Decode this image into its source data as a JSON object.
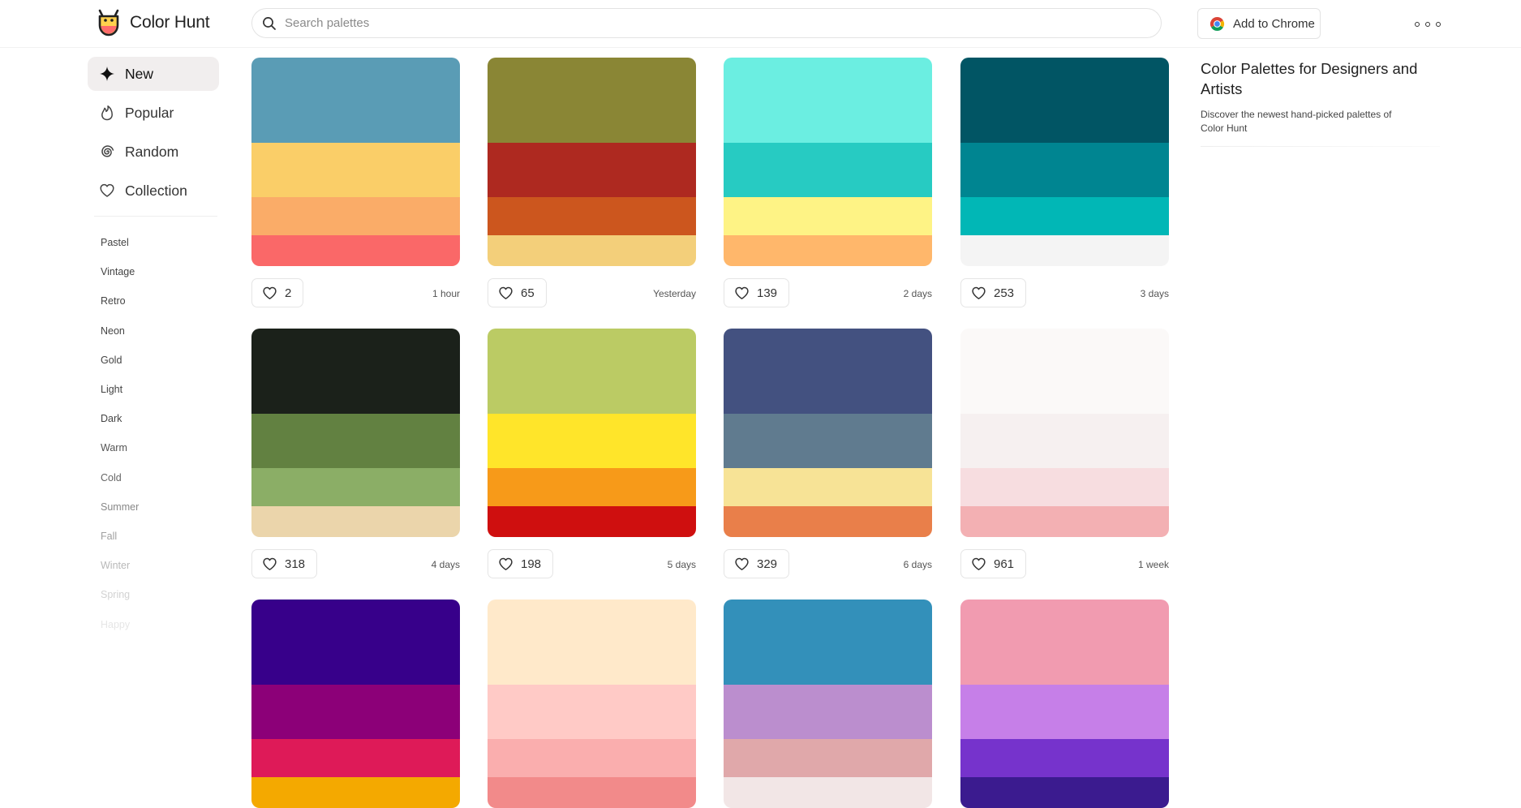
{
  "header": {
    "logo_text": "Color Hunt",
    "search_placeholder": "Search palettes",
    "chrome_label": "Add to Chrome"
  },
  "sidebar": {
    "nav": [
      {
        "label": "New",
        "icon": "sparkle-icon",
        "active": true
      },
      {
        "label": "Popular",
        "icon": "flame-icon",
        "active": false
      },
      {
        "label": "Random",
        "icon": "spiral-icon",
        "active": false
      },
      {
        "label": "Collection",
        "icon": "heart-icon",
        "active": false
      }
    ],
    "tags": [
      {
        "label": "Pastel",
        "color": "#444444"
      },
      {
        "label": "Vintage",
        "color": "#444444"
      },
      {
        "label": "Retro",
        "color": "#444444"
      },
      {
        "label": "Neon",
        "color": "#444444"
      },
      {
        "label": "Gold",
        "color": "#444444"
      },
      {
        "label": "Light",
        "color": "#444444"
      },
      {
        "label": "Dark",
        "color": "#444444"
      },
      {
        "label": "Warm",
        "color": "#555555"
      },
      {
        "label": "Cold",
        "color": "#666666"
      },
      {
        "label": "Summer",
        "color": "#888888"
      },
      {
        "label": "Fall",
        "color": "#a0a0a0"
      },
      {
        "label": "Winter",
        "color": "#b8b8b8"
      },
      {
        "label": "Spring",
        "color": "#d2d2d2"
      },
      {
        "label": "Happy",
        "color": "#e6e6e6"
      }
    ]
  },
  "palettes": [
    {
      "colors": [
        "#5A9CB5",
        "#FACE68",
        "#FAAC68",
        "#FA6868"
      ],
      "likes": "2",
      "time": "1 hour"
    },
    {
      "colors": [
        "#8A8635",
        "#AE2920",
        "#CC561E",
        "#F3CF7A"
      ],
      "likes": "65",
      "time": "Yesterday"
    },
    {
      "colors": [
        "#6BEEE1",
        "#27CBC2",
        "#FEF385",
        "#FFB76B"
      ],
      "likes": "139",
      "time": "2 days"
    },
    {
      "colors": [
        "#015564",
        "#008591",
        "#01B7B6",
        "#F4F4F4"
      ],
      "likes": "253",
      "time": "3 days"
    },
    {
      "colors": [
        "#1B211A",
        "#628141",
        "#8BAE66",
        "#EBD5AB"
      ],
      "likes": "318",
      "time": "4 days"
    },
    {
      "colors": [
        "#BBCB64",
        "#FFE52A",
        "#F79A19",
        "#CF0F0F"
      ],
      "likes": "198",
      "time": "5 days"
    },
    {
      "colors": [
        "#435180",
        "#607B8F",
        "#F7E396",
        "#E97F4A"
      ],
      "likes": "329",
      "time": "6 days"
    },
    {
      "colors": [
        "#FBF9F8",
        "#F6F0F0",
        "#F7DDE0",
        "#F3B0B3"
      ],
      "likes": "961",
      "time": "1 week"
    },
    {
      "colors": [
        "#37008A",
        "#8C0078",
        "#DE1A58",
        "#F4A900"
      ],
      "likes": "",
      "time": ""
    },
    {
      "colors": [
        "#FFE9CA",
        "#FFCAC6",
        "#FAAEAE",
        "#F28A8A"
      ],
      "likes": "",
      "time": ""
    },
    {
      "colors": [
        "#3390BA",
        "#BB8ECE",
        "#E0A8AA",
        "#F2E6E6"
      ],
      "likes": "",
      "time": ""
    },
    {
      "colors": [
        "#F19BB0",
        "#C67FE8",
        "#7633CC",
        "#3B1B8F"
      ],
      "likes": "",
      "time": ""
    }
  ],
  "right_panel": {
    "title": "Color Palettes for Designers and Artists",
    "description": "Discover the newest hand-picked palettes of Color Hunt"
  }
}
